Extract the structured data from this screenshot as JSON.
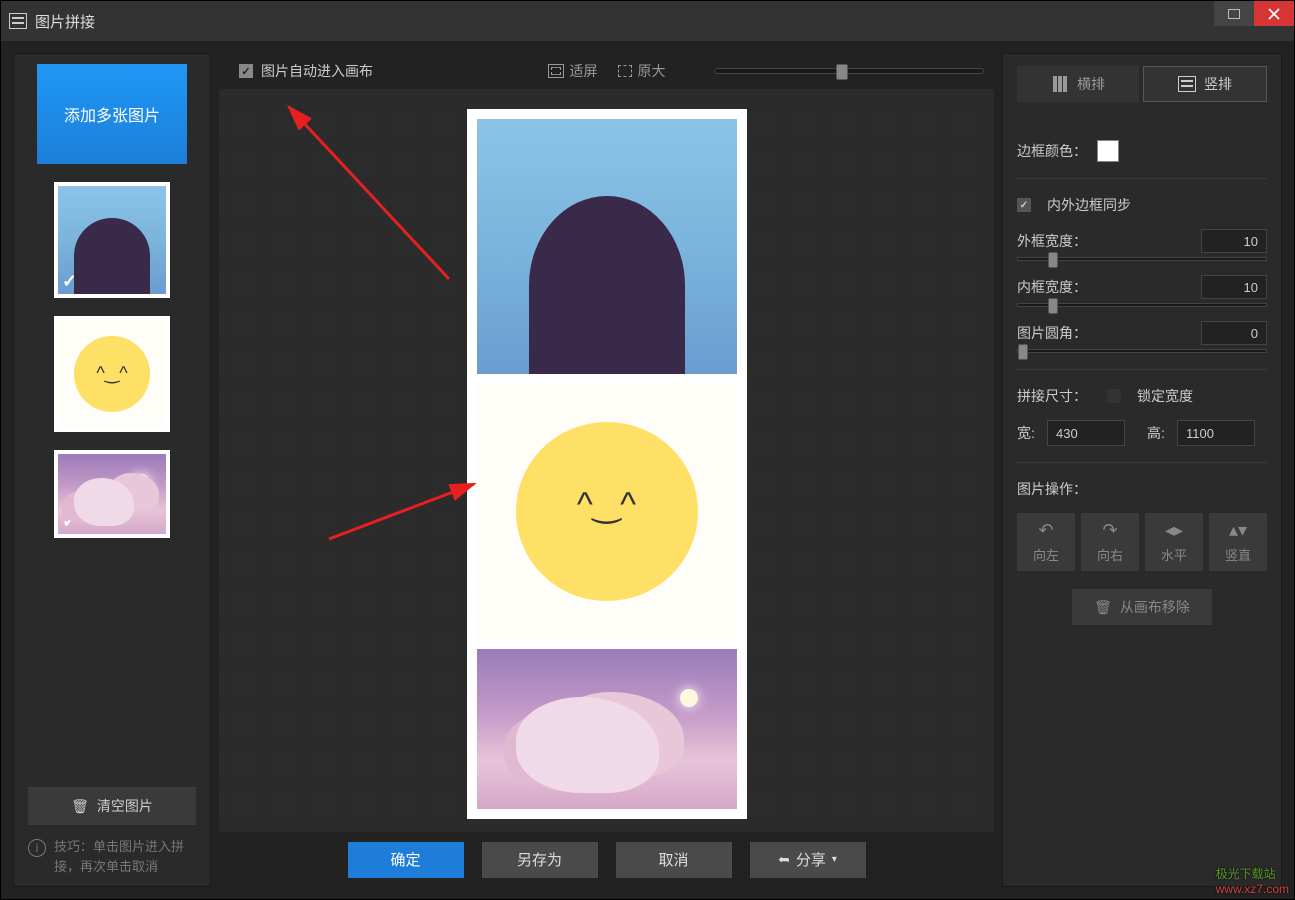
{
  "titlebar": {
    "title": "图片拼接"
  },
  "left": {
    "add_button": "添加多张图片",
    "clear_button": "清空图片",
    "tip": "技巧：单击图片进入拼接，再次单击取消"
  },
  "toolbar": {
    "auto_canvas": "图片自动进入画布",
    "fit": "适屏",
    "original": "原大"
  },
  "bottom": {
    "ok": "确定",
    "save_as": "另存为",
    "cancel": "取消",
    "share": "分享"
  },
  "right": {
    "layout_h": "横排",
    "layout_v": "竖排",
    "border_color": "边框颜色：",
    "sync_border": "内外边框同步",
    "outer_width_label": "外框宽度：",
    "outer_width_value": "10",
    "inner_width_label": "内框宽度：",
    "inner_width_value": "10",
    "radius_label": "图片圆角：",
    "radius_value": "0",
    "stitch_size": "拼接尺寸：",
    "lock_width": "锁定宽度",
    "width_label": "宽:",
    "width_value": "430",
    "height_label": "高:",
    "height_value": "1100",
    "ops_label": "图片操作：",
    "rotate_left": "向左",
    "rotate_right": "向右",
    "flip_h": "水平",
    "flip_v": "竖直",
    "remove": "从画布移除"
  },
  "watermark": {
    "line1": "极光下载站",
    "line2": "www.xz7.com"
  }
}
